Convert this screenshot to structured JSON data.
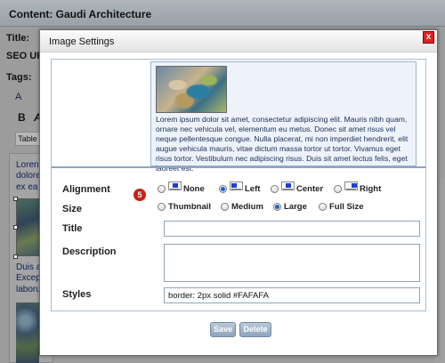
{
  "background": {
    "header_title": "Content: Gaudi Architecture",
    "labels": {
      "title": "Title:",
      "seo": "SEO UF",
      "tags": "Tags:"
    },
    "toolbar": {
      "icons_text": "A",
      "bold_text": "B",
      "italic_text": "A",
      "table_button": "Table"
    },
    "editor_lines": [
      "Loren",
      "dolore",
      "ex ea",
      "Duis a",
      "Excep",
      "laboru"
    ]
  },
  "dialog": {
    "title": "Image Settings",
    "close_label": "x",
    "preview_text": "Lorem ipsum dolor sit amet, consectetur adipiscing elit. Mauris nibh quam, ornare nec vehicula vel, elementum eu metus. Donec sit amet risus vel neque pellentesque congue. Nulla placerat, mi non imperdiet hendrerit, elit augue vehicula mauris, vitae dictum massa tortor ut tortor. Vivamus eget risus tortor. Vestibulum nec adipiscing risus. Duis sit amet lectus felis, eget laoreet est.",
    "step_badge": "5",
    "alignment": {
      "label": "Alignment",
      "options": [
        "None",
        "Left",
        "Center",
        "Right"
      ],
      "selected": "Left"
    },
    "size": {
      "label": "Size",
      "options": [
        "Thumbnail",
        "Medium",
        "Large",
        "Full Size"
      ],
      "selected": "Large"
    },
    "title_field": {
      "label": "Title",
      "value": ""
    },
    "description_field": {
      "label": "Description",
      "value": ""
    },
    "styles_field": {
      "label": "Styles",
      "value": "border: 2px solid #FAFAFA"
    },
    "buttons": {
      "save": "Save",
      "delete": "Delete"
    }
  },
  "colors": {
    "accent": "#1a63c9",
    "close_red": "#d22222",
    "badge_red": "#cc1f16",
    "button_blue": "#8ea5bd"
  }
}
